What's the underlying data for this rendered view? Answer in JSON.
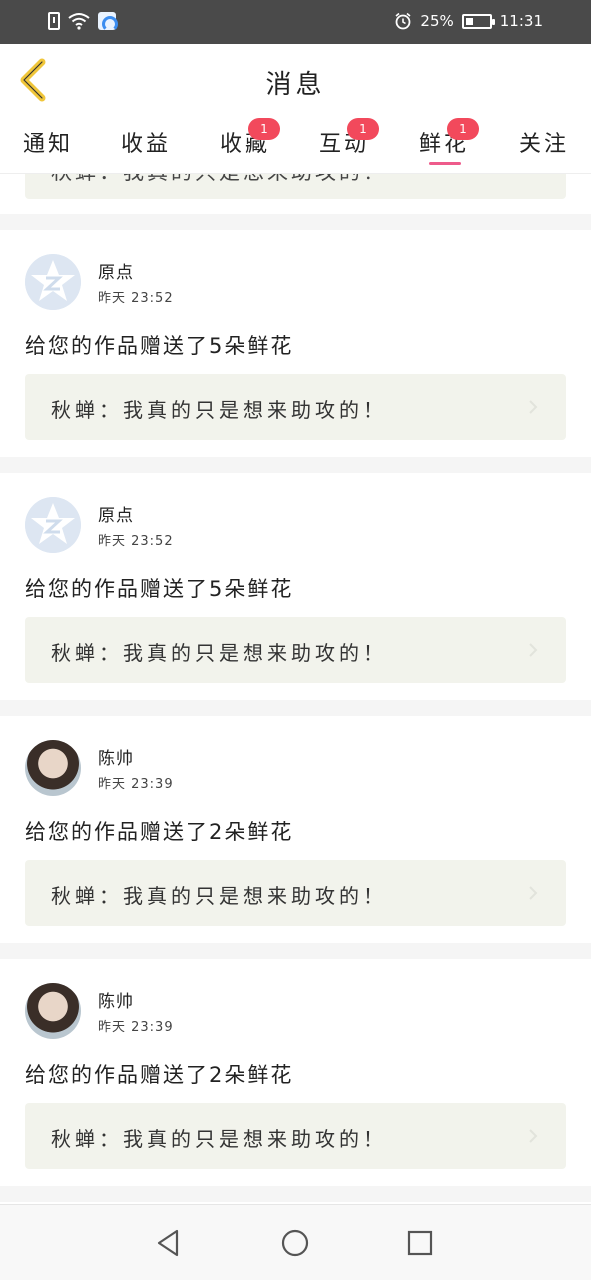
{
  "status_bar": {
    "battery": "25%",
    "time": "11:31"
  },
  "header": {
    "title": "消息"
  },
  "tabs": [
    {
      "label": "通知",
      "badge": ""
    },
    {
      "label": "收益",
      "badge": ""
    },
    {
      "label": "收藏",
      "badge": "1"
    },
    {
      "label": "互动",
      "badge": "1"
    },
    {
      "label": "鲜花",
      "badge": "1"
    },
    {
      "label": "关注",
      "badge": ""
    }
  ],
  "active_tab": "鲜花",
  "partial_quote": "秋蝉：我真的只是想来助攻的！",
  "messages": [
    {
      "user": "原点",
      "time": "昨天 23:52",
      "text": "给您的作品赠送了5朵鲜花",
      "quote": "秋蝉：我真的只是想来助攻的！",
      "avatar": "default-avatar"
    },
    {
      "user": "原点",
      "time": "昨天 23:52",
      "text": "给您的作品赠送了5朵鲜花",
      "quote": "秋蝉：我真的只是想来助攻的！",
      "avatar": "default-avatar"
    },
    {
      "user": "陈帅",
      "time": "昨天 23:39",
      "text": "给您的作品赠送了2朵鲜花",
      "quote": "秋蝉：我真的只是想来助攻的！",
      "avatar": "photo-avatar"
    },
    {
      "user": "陈帅",
      "time": "昨天 23:39",
      "text": "给您的作品赠送了2朵鲜花",
      "quote": "秋蝉：我真的只是想来助攻的！",
      "avatar": "photo-avatar"
    }
  ],
  "colors": {
    "accent": "#ee5b8b",
    "badge": "#f2495c",
    "back_arrow": "#f0c63a",
    "quote_bg": "#f2f3ec"
  }
}
